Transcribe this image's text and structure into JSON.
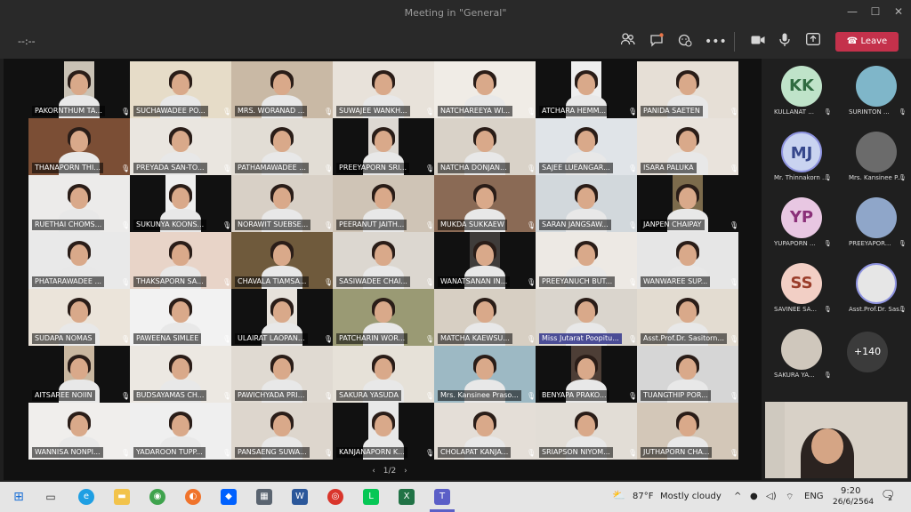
{
  "window": {
    "title": "Meeting in \"General\""
  },
  "toolbar": {
    "timer": "--:--",
    "leave_label": "Leave",
    "icons": [
      "people-icon",
      "chat-icon",
      "reactions-icon",
      "more-icon",
      "camera-icon",
      "mic-icon",
      "share-icon"
    ]
  },
  "grid": {
    "pager": "1/2",
    "tiles": [
      {
        "name": "PAKORNTHUM TA...",
        "bg": "#c9c2b5"
      },
      {
        "name": "SUCHAWADEE PO...",
        "bg": "#e6dcc8"
      },
      {
        "name": "MRS. WORANAD ...",
        "bg": "#c9b9a5"
      },
      {
        "name": "SUWAJEE WANKH...",
        "bg": "#e8e2da"
      },
      {
        "name": "NATCHAREEYA WI...",
        "bg": "#f0ece6"
      },
      {
        "name": "ATCHARA HEMM...",
        "bg": "#eeeeee"
      },
      {
        "name": "PANIDA SAETEN",
        "bg": "#e6dfd6"
      },
      {
        "name": "THANAPORN THI...",
        "bg": "#7b4e35"
      },
      {
        "name": "PREYADA SAN-TO...",
        "bg": "#eae6e0"
      },
      {
        "name": "PATHAMAWADEE ...",
        "bg": "#e2ddd5"
      },
      {
        "name": "PREEYAPORN SRI...",
        "bg": "#ddd8d2"
      },
      {
        "name": "NATCHA DONJAN...",
        "bg": "#d9d2c8"
      },
      {
        "name": "SAJEE LUEANGAR...",
        "bg": "#e0e4e8"
      },
      {
        "name": "ISARA PALUKA",
        "bg": "#e9e3dc"
      },
      {
        "name": "RUETHAI CHOMS...",
        "bg": "#ecebea"
      },
      {
        "name": "SUKUNYA KOONS...",
        "bg": "#efefef"
      },
      {
        "name": "NORAWIT SUEBSE...",
        "bg": "#d8d0c6"
      },
      {
        "name": "PEERANUT JAITH...",
        "bg": "#cfc4b6"
      },
      {
        "name": "MUKDA SUKKAEW",
        "bg": "#8a6a55"
      },
      {
        "name": "SARAN JANGSAW...",
        "bg": "#d2d8dc"
      },
      {
        "name": "JANPEN CHAIPAY",
        "bg": "#7c6b4c"
      },
      {
        "name": "PHATARAWADEE ...",
        "bg": "#e9e9e9"
      },
      {
        "name": "THAKSAPORN SA...",
        "bg": "#e8d4c8"
      },
      {
        "name": "CHAVALA TIAMSA...",
        "bg": "#6f5a3c"
      },
      {
        "name": "SASIWADEE CHAI...",
        "bg": "#dcd7d0"
      },
      {
        "name": "WANATSANAN IN...",
        "bg": "#3f3c3a"
      },
      {
        "name": "PREEYANUCH BUT...",
        "bg": "#ede9e4"
      },
      {
        "name": "WANWAREE SUP...",
        "bg": "#e6e6e6"
      },
      {
        "name": "SUDAPA NOMAS",
        "bg": "#ebe4da"
      },
      {
        "name": "PAWEENA SIMLEE",
        "bg": "#f2f2f2"
      },
      {
        "name": "ULAIRAT LAOPAN...",
        "bg": "#e7e2db"
      },
      {
        "name": "PATCHARIN WOR...",
        "bg": "#9a9a74"
      },
      {
        "name": "MATCHA KAEWSU...",
        "bg": "#d7cfc3"
      },
      {
        "name": "Miss Jutarat Poopitu...",
        "bg": "#dad5cd",
        "highlight": true
      },
      {
        "name": "Asst.Prof.Dr. Sasitorn...",
        "bg": "#e3dcd1"
      },
      {
        "name": "AITSAREE NOIIN",
        "bg": "#c9b7a0"
      },
      {
        "name": "BUDSAYAMAS CH...",
        "bg": "#ece8e2"
      },
      {
        "name": "PAWICHYADA PRI...",
        "bg": "#e0dad2"
      },
      {
        "name": "SAKURA YASUDA",
        "bg": "#e6e1d8"
      },
      {
        "name": "Mrs. Kansinee Praso...",
        "bg": "#9db9c4"
      },
      {
        "name": "BENYAPA PRAKO...",
        "bg": "#4d3e36"
      },
      {
        "name": "TUANGTHIP POR...",
        "bg": "#d6d6d6"
      },
      {
        "name": "WANNISA NONPI...",
        "bg": "#f0eeec"
      },
      {
        "name": "YADAROON TUPP...",
        "bg": "#efefef"
      },
      {
        "name": "PANSAENG SUWA...",
        "bg": "#ddd6cd"
      },
      {
        "name": "KANJANAPORN K...",
        "bg": "#e8e8e8"
      },
      {
        "name": "CHOLAPAT KANJA...",
        "bg": "#e4ded7"
      },
      {
        "name": "SRIAPSON NIYOM...",
        "bg": "#e2ddd6"
      },
      {
        "name": "JUTHAPORN CHA...",
        "bg": "#d3c7b8"
      }
    ]
  },
  "sidebar": {
    "people": [
      {
        "name": "KULLANAT ...",
        "initials": "KK",
        "color": "#bfe3c9",
        "text_color": "#2f6b40"
      },
      {
        "name": "SURINTON ...",
        "initials": "",
        "color": "#7fb6c9",
        "text_color": "#ffffff"
      },
      {
        "name": "Mr. Thinnakorn ...",
        "initials": "MJ",
        "color": "#c9d3f0",
        "text_color": "#36478c",
        "ring": true
      },
      {
        "name": "Mrs. Kansinee P...",
        "initials": "",
        "color": "#6b6b6b",
        "text_color": "#ffffff"
      },
      {
        "name": "YUPAPORN ...",
        "initials": "YP",
        "color": "#e8c7e2",
        "text_color": "#8a2f78"
      },
      {
        "name": "PREEYAPOR...",
        "initials": "",
        "color": "#8fa6c9",
        "text_color": "#ffffff"
      },
      {
        "name": "SAVINEE SA...",
        "initials": "SS",
        "color": "#f2cfc5",
        "text_color": "#9a3d2a"
      },
      {
        "name": "Asst.Prof.Dr. Sas...",
        "initials": "",
        "color": "#e6e6e6",
        "text_color": "#333333",
        "ring": true
      },
      {
        "name": "SAKURA YA...",
        "initials": "",
        "color": "#cfc7bc",
        "text_color": "#333333"
      }
    ],
    "more_count": "+140"
  },
  "taskbar": {
    "weather_temp": "87°F",
    "weather_text": "Mostly cloudy",
    "language": "ENG",
    "time": "9:20",
    "date": "26/6/2564",
    "notifications": "2"
  },
  "colors": {
    "leave": "#c4314b",
    "highlight": "#4b4d96"
  }
}
